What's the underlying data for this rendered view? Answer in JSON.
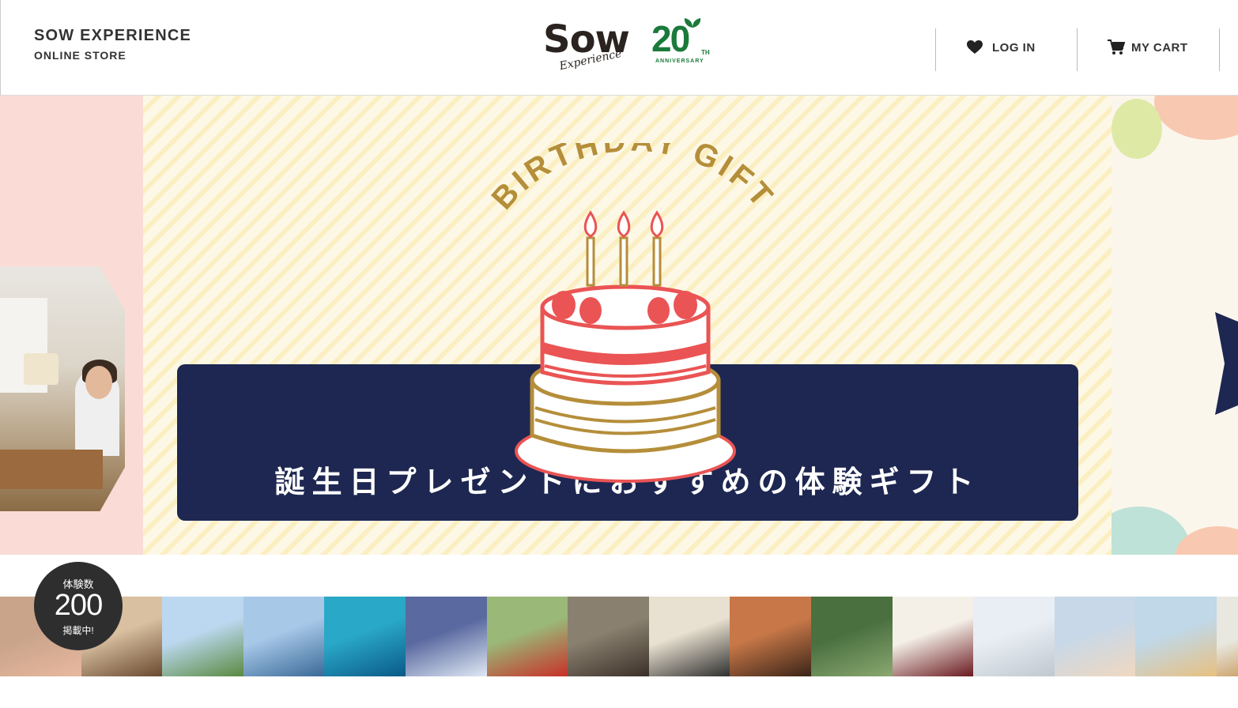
{
  "header": {
    "store_title": "SOW EXPERIENCE",
    "store_subtitle": "ONLINE STORE",
    "logo_sow": "Sow",
    "logo_experience": "Experience",
    "logo_20": "20",
    "logo_th": "TH",
    "logo_anniversary": "ANNIVERSARY",
    "login_label": "LOG IN",
    "cart_label": "MY CART"
  },
  "hero": {
    "arc_text": "BIRTHDAY GIFT",
    "banner_text": "誕生日プレゼントにおすすめの体験ギフト"
  },
  "badge": {
    "top": "体験数",
    "count": "200",
    "bottom": "掲載中!"
  },
  "thumbnails": [
    {
      "name": "thumb-spa",
      "colors": [
        "#c9a48a",
        "#e8b8a0"
      ]
    },
    {
      "name": "thumb-horse",
      "colors": [
        "#d8c0a0",
        "#6a4a30"
      ]
    },
    {
      "name": "thumb-paragliding",
      "colors": [
        "#bcd8f0",
        "#5a8a40"
      ]
    },
    {
      "name": "thumb-canoe",
      "colors": [
        "#a8c8e8",
        "#3a6a98"
      ]
    },
    {
      "name": "thumb-sea-turtle",
      "colors": [
        "#2aa8c8",
        "#0a5a88"
      ]
    },
    {
      "name": "thumb-cruise",
      "colors": [
        "#5a6aa0",
        "#e0e8f4"
      ]
    },
    {
      "name": "thumb-bus",
      "colors": [
        "#9ab878",
        "#c83028"
      ]
    },
    {
      "name": "thumb-shoes",
      "colors": [
        "#8a8070",
        "#3a3028"
      ]
    },
    {
      "name": "thumb-cooking",
      "colors": [
        "#e8e0d0",
        "#303030"
      ]
    },
    {
      "name": "thumb-leather",
      "colors": [
        "#c87848",
        "#3a2418"
      ]
    },
    {
      "name": "thumb-forest",
      "colors": [
        "#4a7040",
        "#8aa870"
      ]
    },
    {
      "name": "thumb-wine",
      "colors": [
        "#f4f0e8",
        "#6a1a20"
      ]
    },
    {
      "name": "thumb-ski",
      "colors": [
        "#e8eef4",
        "#c0c8d0"
      ]
    },
    {
      "name": "thumb-helicopter",
      "colors": [
        "#c8d8e8",
        "#f0d8c0"
      ]
    },
    {
      "name": "thumb-pancakes",
      "colors": [
        "#c0d8e8",
        "#e8c080"
      ]
    },
    {
      "name": "thumb-burger",
      "colors": [
        "#e8e8e0",
        "#c08030"
      ]
    }
  ]
}
